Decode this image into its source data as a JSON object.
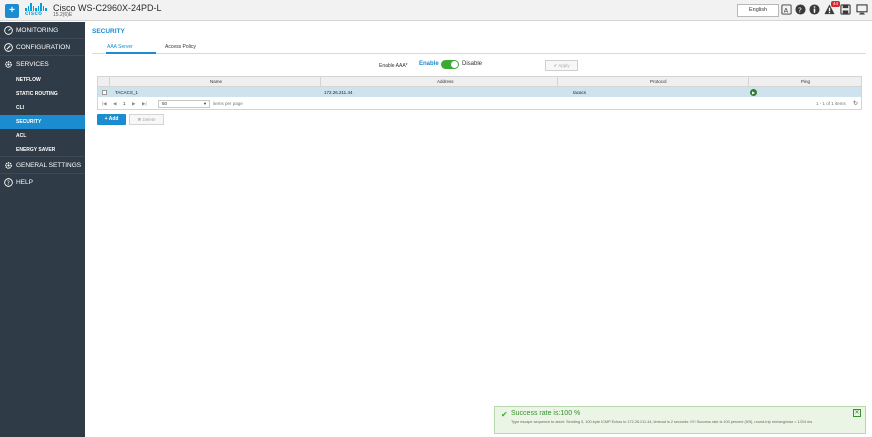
{
  "header": {
    "home_icon": "plus-icon",
    "logo_text": "cisco",
    "device_title": "Cisco WS-C2960X-24PD-L",
    "device_subtitle": "15.2(6)E",
    "language": "English",
    "alert_count": "44",
    "accent": "#1b8cd0"
  },
  "sidebar": {
    "bg": "#2f3b46",
    "sections": [
      {
        "label": "MONITORING",
        "icon": "gauge-icon"
      },
      {
        "label": "CONFIGURATION",
        "icon": "wrench-icon"
      },
      {
        "label": "SERVICES",
        "icon": "gear-icon"
      }
    ],
    "services_items": [
      "NETFLOW",
      "STATIC ROUTING",
      "CLI",
      "SECURITY",
      "ACL",
      "ENERGY SAVER"
    ],
    "active_item": "SECURITY",
    "bottom_sections": [
      {
        "label": "GENERAL SETTINGS",
        "icon": "gear-icon"
      },
      {
        "label": "HELP",
        "icon": "help-icon"
      }
    ]
  },
  "main": {
    "title": "SECURITY",
    "tabs": [
      {
        "label": "AAA Server",
        "active": true
      },
      {
        "label": "Access Policy",
        "active": false
      }
    ],
    "enable_aaa_label": "Enable AAA*",
    "enable_label": "Enable",
    "disable_label": "Disable",
    "apply_label": "✔ Apply",
    "table": {
      "columns": [
        "Name",
        "Address",
        "Protocol",
        "Ping"
      ],
      "rows": [
        {
          "name": "TACACS_1",
          "address": "172.26.211.44",
          "protocol": "tacacs"
        }
      ],
      "page_number": "1",
      "page_size": "50",
      "items_per_page": "items per page",
      "range_text": "1 - 1 of 1 items"
    },
    "add_label": "+ Add",
    "delete_label": "✖ Delete"
  },
  "toast": {
    "title": "Success rate is:100 %",
    "message": "Type escape sequence to abort. Sending 5, 100-byte ICMP Echos to 172.26.211.44, timeout is 2 seconds: !!!!! Success rate is 100 percent (5/5), round-trip min/avg/max = 1/2/4 ms",
    "color": "#3aaa35"
  }
}
